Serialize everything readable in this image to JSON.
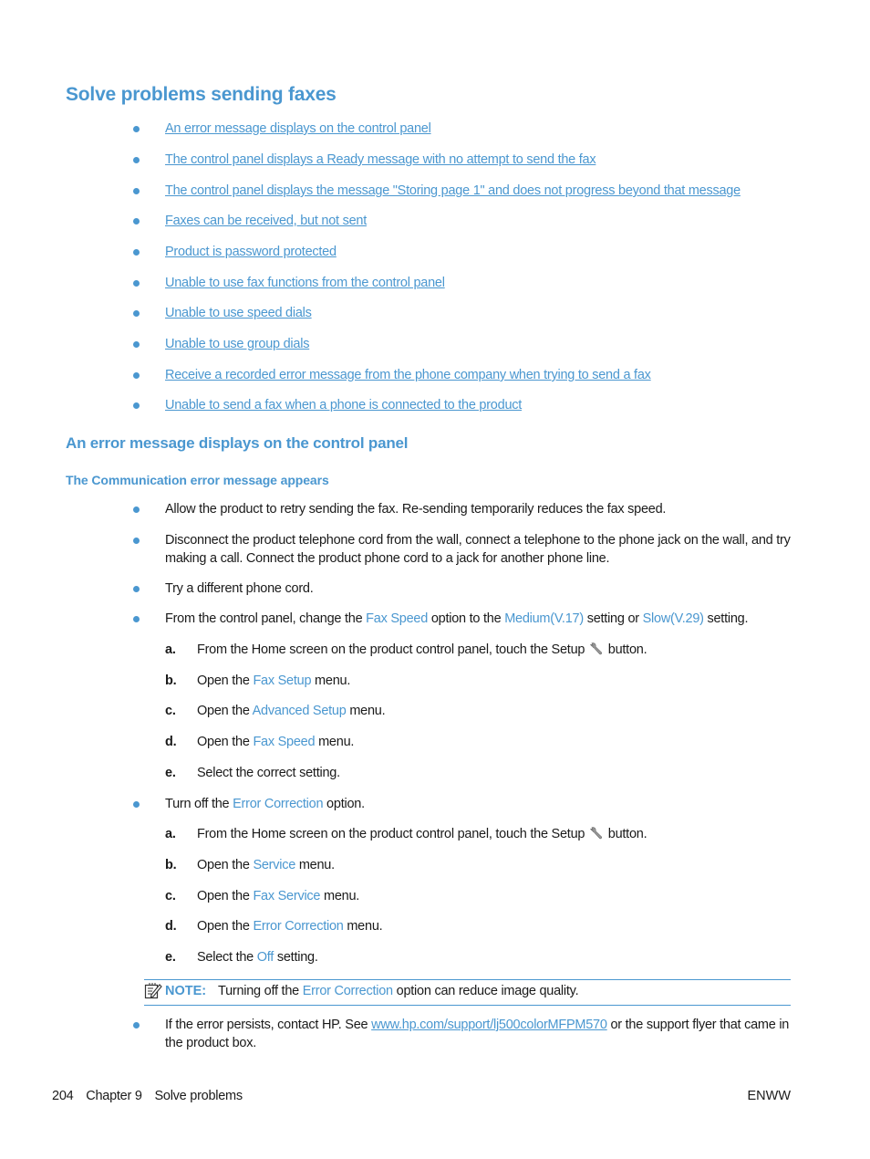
{
  "title": "Solve problems sending faxes",
  "toc_links": [
    "An error message displays on the control panel",
    "The control panel displays a Ready message with no attempt to send the fax",
    "The control panel displays the message \"Storing page 1\" and does not progress beyond that message",
    "Faxes can be received, but not sent",
    "Product is password protected",
    "Unable to use fax functions from the control panel",
    "Unable to use speed dials",
    "Unable to use group dials",
    "Receive a recorded error message from the phone company when trying to send a fax",
    "Unable to send a fax when a phone is connected to the product"
  ],
  "section_heading": "An error message displays on the control panel",
  "subsection_heading": "The Communication error message appears",
  "bullets": {
    "b1": "Allow the product to retry sending the fax. Re-sending temporarily reduces the fax speed.",
    "b2": "Disconnect the product telephone cord from the wall, connect a telephone to the phone jack on the wall, and try making a call. Connect the product phone cord to a jack for another phone line.",
    "b3": "Try a different phone cord.",
    "b4": {
      "pre": "From the control panel, change the ",
      "term1": "Fax Speed",
      "mid1": " option to the ",
      "term2": "Medium(V.17)",
      "mid2": " setting or ",
      "term3": "Slow(V.29)",
      "post": " setting."
    },
    "b5": {
      "pre": "Turn off the ",
      "term": "Error Correction",
      "post": " option."
    },
    "b6": {
      "pre": "If the error persists, contact HP. See ",
      "link": "www.hp.com/support/lj500colorMFPM570",
      "post": " or the support flyer that came in the product box."
    }
  },
  "steps_fax_speed": [
    {
      "letter": "a.",
      "pre": "From the Home screen on the product control panel, touch the Setup ",
      "term": "",
      "post": " button.",
      "icon": "wrench-icon"
    },
    {
      "letter": "b.",
      "pre": "Open the ",
      "term": "Fax Setup",
      "post": " menu."
    },
    {
      "letter": "c.",
      "pre": "Open the ",
      "term": "Advanced Setup",
      "post": " menu."
    },
    {
      "letter": "d.",
      "pre": "Open the ",
      "term": "Fax Speed",
      "post": " menu."
    },
    {
      "letter": "e.",
      "pre": "Select the correct setting.",
      "term": "",
      "post": ""
    }
  ],
  "steps_error_correction": [
    {
      "letter": "a.",
      "pre": "From the Home screen on the product control panel, touch the Setup ",
      "term": "",
      "post": " button.",
      "icon": "wrench-icon"
    },
    {
      "letter": "b.",
      "pre": "Open the ",
      "term": "Service",
      "post": " menu."
    },
    {
      "letter": "c.",
      "pre": "Open the ",
      "term": "Fax Service",
      "post": " menu."
    },
    {
      "letter": "d.",
      "pre": "Open the ",
      "term": "Error Correction",
      "post": " menu."
    },
    {
      "letter": "e.",
      "pre": "Select the ",
      "term": "Off",
      "post": " setting."
    }
  ],
  "note": {
    "label": "NOTE:",
    "pre": "Turning off the ",
    "term": "Error Correction",
    "post": " option can reduce image quality."
  },
  "footer": {
    "page_number": "204",
    "chapter": "Chapter 9",
    "chapter_title": "Solve problems",
    "right": "ENWW"
  },
  "colors": {
    "accent": "#4a97d0",
    "text": "#1a1a1a"
  }
}
